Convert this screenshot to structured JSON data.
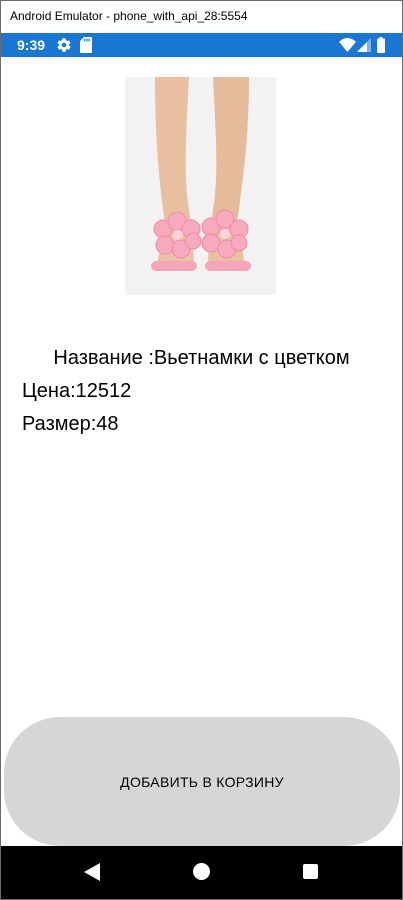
{
  "window": {
    "title": "Android Emulator - phone_with_api_28:5554"
  },
  "status_bar": {
    "time": "9:39",
    "background_color": "#1976d2",
    "icons": [
      "gear-icon",
      "sd-card-icon",
      "wifi-icon",
      "signal-icon",
      "battery-icon"
    ]
  },
  "product": {
    "image_icon": "flower-slides-photo",
    "name_text": "Название :Вьетнамки с цветком",
    "price_text": "Цена:12512",
    "size_text": "Размер:48"
  },
  "actions": {
    "add_to_cart_label": "ДОБАВИТЬ В КОРЗИНУ",
    "button_color": "#d6d6d6"
  },
  "nav_bar": {
    "icons": [
      "back-icon",
      "home-icon",
      "recents-icon"
    ]
  }
}
